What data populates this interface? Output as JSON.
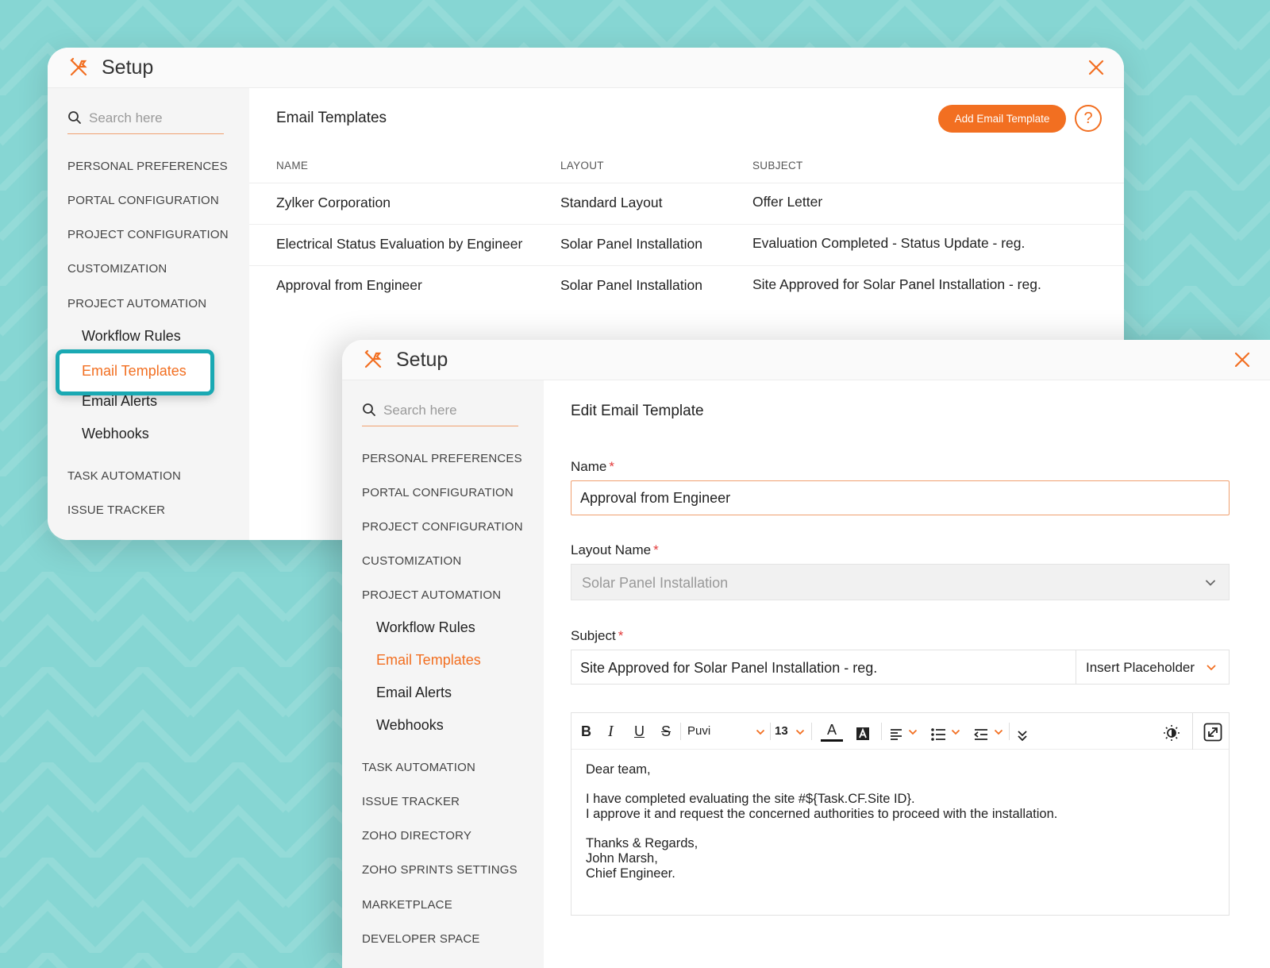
{
  "colors": {
    "accent": "#f26f21",
    "teal_highlight": "#1aa9b3",
    "background": "#86d6d3"
  },
  "icons": {
    "app": "tools-icon",
    "close": "close-icon",
    "search": "search-icon",
    "help": "question-mark-icon"
  },
  "back_window": {
    "title": "Setup",
    "search_placeholder": "Search here",
    "nav": {
      "personal_preferences": "PERSONAL PREFERENCES",
      "portal_configuration": "PORTAL CONFIGURATION",
      "project_configuration": "PROJECT CONFIGURATION",
      "customization": "CUSTOMIZATION",
      "project_automation": "PROJECT AUTOMATION",
      "workflow_rules": "Workflow Rules",
      "email_templates": "Email Templates",
      "email_alerts": "Email Alerts",
      "webhooks": "Webhooks",
      "task_automation": "TASK AUTOMATION",
      "issue_tracker": "ISSUE TRACKER"
    },
    "page_title": "Email Templates",
    "add_button": "Add Email Template",
    "help_label": "?",
    "table": {
      "headers": {
        "name": "NAME",
        "layout": "LAYOUT",
        "subject": "SUBJECT"
      },
      "rows": [
        {
          "name": "Zylker Corporation",
          "layout": "Standard Layout",
          "subject": "Offer Letter"
        },
        {
          "name": "Electrical Status Evaluation by Engineer",
          "layout": "Solar Panel Installation",
          "subject": "Evaluation Completed - Status Update - reg."
        },
        {
          "name": "Approval from Engineer",
          "layout": "Solar Panel Installation",
          "subject": "Site Approved for Solar Panel Installation - reg."
        }
      ]
    }
  },
  "front_window": {
    "title": "Setup",
    "search_placeholder": "Search here",
    "nav": {
      "personal_preferences": "PERSONAL PREFERENCES",
      "portal_configuration": "PORTAL CONFIGURATION",
      "project_configuration": "PROJECT CONFIGURATION",
      "customization": "CUSTOMIZATION",
      "project_automation": "PROJECT AUTOMATION",
      "workflow_rules": "Workflow Rules",
      "email_templates": "Email Templates",
      "email_alerts": "Email Alerts",
      "webhooks": "Webhooks",
      "task_automation": "TASK AUTOMATION",
      "issue_tracker": "ISSUE TRACKER",
      "zoho_directory": "ZOHO DIRECTORY",
      "zoho_sprints_settings": "ZOHO SPRINTS SETTINGS",
      "marketplace": "MARKETPLACE",
      "developer_space": "DEVELOPER SPACE"
    },
    "form": {
      "title": "Edit Email Template",
      "required_mark": "*",
      "name_label": "Name",
      "name_value": "Approval from Engineer",
      "layout_label": "Layout Name",
      "layout_value": "Solar Panel Installation",
      "subject_label": "Subject",
      "subject_value": "Site Approved for Solar Panel Installation - reg.",
      "insert_placeholder": "Insert Placeholder"
    },
    "editor": {
      "toolbar": {
        "bold": "B",
        "italic": "I",
        "underline": "U",
        "strike": "S",
        "font": "Puvi",
        "size": "13",
        "font_color": "A"
      },
      "body": {
        "greeting": "Dear team,",
        "line1": "I have completed evaluating the site #${Task.CF.Site ID}.",
        "line2": "I approve it and request the concerned authorities to proceed with the installation.",
        "sign1": "Thanks & Regards,",
        "sign2": "John Marsh,",
        "sign3": "Chief Engineer."
      }
    }
  }
}
